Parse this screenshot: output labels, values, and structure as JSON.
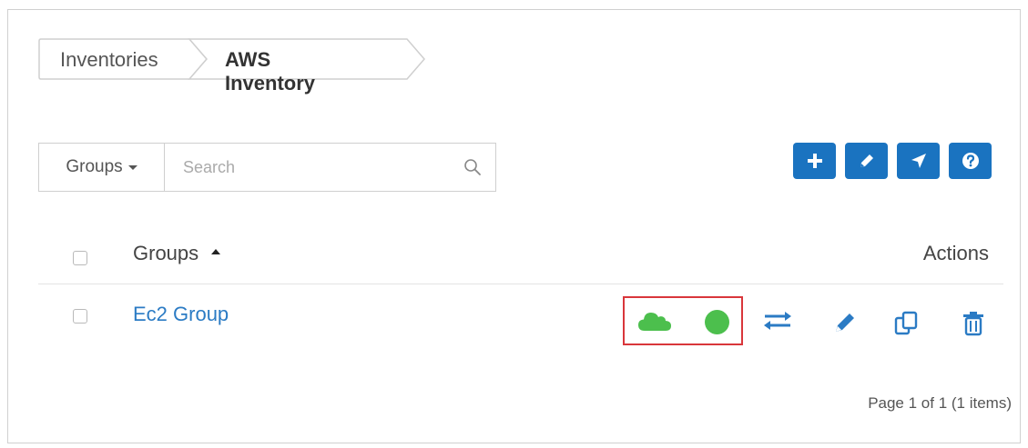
{
  "breadcrumb": {
    "items": [
      "Inventories",
      "AWS Inventory"
    ]
  },
  "search": {
    "dropdown_label": "Groups",
    "placeholder": "Search"
  },
  "toolbar": {
    "buttons": [
      "plus-icon",
      "pencil-icon",
      "location-arrow-icon",
      "question-icon"
    ]
  },
  "table": {
    "header": {
      "name": "Groups",
      "actions": "Actions"
    },
    "rows": [
      {
        "name": "Ec2 Group",
        "cloud_status_color": "#4cbf4d",
        "status_color": "#4cbf4d"
      }
    ]
  },
  "pagination": {
    "text": "Page 1 of 1 (1 items)"
  },
  "colors": {
    "accent": "#1a73c0",
    "link": "#2b7bc4",
    "success": "#4cbf4d",
    "highlight": "#d9363b"
  }
}
